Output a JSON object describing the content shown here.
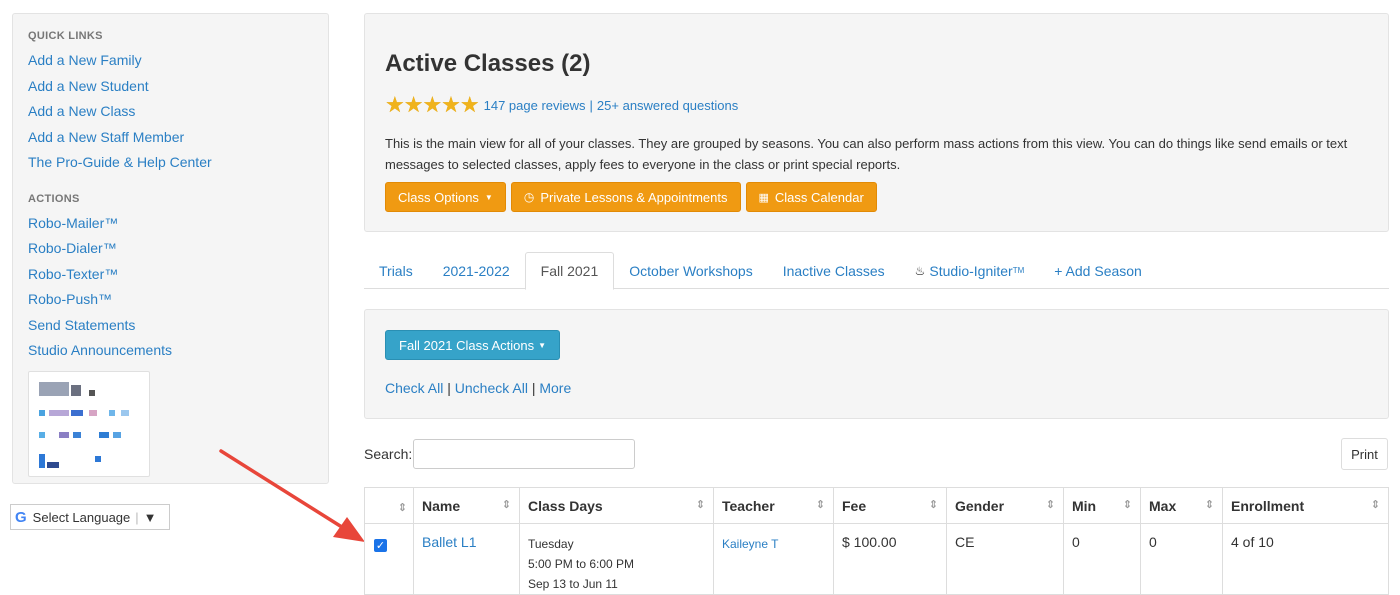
{
  "sidebar": {
    "quick_links_heading": "QUICK LINKS",
    "quick_links": [
      "Add a New Family",
      "Add a New Student",
      "Add a New Class",
      "Add a New Staff Member",
      "The Pro-Guide & Help Center"
    ],
    "actions_heading": "ACTIONS",
    "actions": [
      "Robo-Mailer™",
      "Robo-Dialer™",
      "Robo-Texter™",
      "Robo-Push™",
      "Send Statements",
      "Studio Announcements"
    ]
  },
  "language": {
    "label": "Select Language",
    "caret": "▼",
    "logo": "G"
  },
  "header": {
    "title": "Active Classes (2)",
    "stars": "★★★★★",
    "reviews": "147 page reviews",
    "separator": "|",
    "questions": "25+ answered questions",
    "description": "This is the main view for all of your classes. They are grouped by seasons. You can also perform mass actions from this view. You can do things like send emails or text messages to selected classes, apply fees to everyone in the class or print special reports.",
    "buttons": {
      "class_options": "Class Options",
      "private_lessons": "Private Lessons & Appointments",
      "calendar": "Class Calendar"
    }
  },
  "tabs": {
    "trials": "Trials",
    "season_2021_2022": "2021-2022",
    "fall_2021": "Fall 2021",
    "october": "October Workshops",
    "inactive": "Inactive Classes",
    "igniter": "Studio-Igniter",
    "igniter_tm": "TM",
    "add_season": "+ Add Season"
  },
  "season_panel": {
    "actions_button": "Fall 2021 Class Actions",
    "check_all": "Check All",
    "uncheck_all": "Uncheck All",
    "more": "More",
    "sep": "|"
  },
  "search": {
    "label": "Search:",
    "value": "",
    "print": "Print"
  },
  "table": {
    "columns": {
      "name": "Name",
      "days": "Class Days",
      "teacher": "Teacher",
      "fee": "Fee",
      "gender": "Gender",
      "min": "Min",
      "max": "Max",
      "enrollment": "Enrollment"
    },
    "sort_icon": "⇕",
    "rows": [
      {
        "checked": true,
        "name": "Ballet L1",
        "day": "Tuesday",
        "time": "5:00 PM to 6:00 PM",
        "dates": "Sep 13 to Jun 11",
        "teacher": "Kaileyne T",
        "fee": "$ 100.00",
        "gender": "CE",
        "min": "0",
        "max": "0",
        "enrollment": "4 of 10"
      }
    ]
  },
  "colors": {
    "link": "#2a7fc4",
    "orange": "#f09a12",
    "blue_button": "#36a3c9",
    "star": "#f0b31c",
    "arrow": "#e8463a"
  }
}
